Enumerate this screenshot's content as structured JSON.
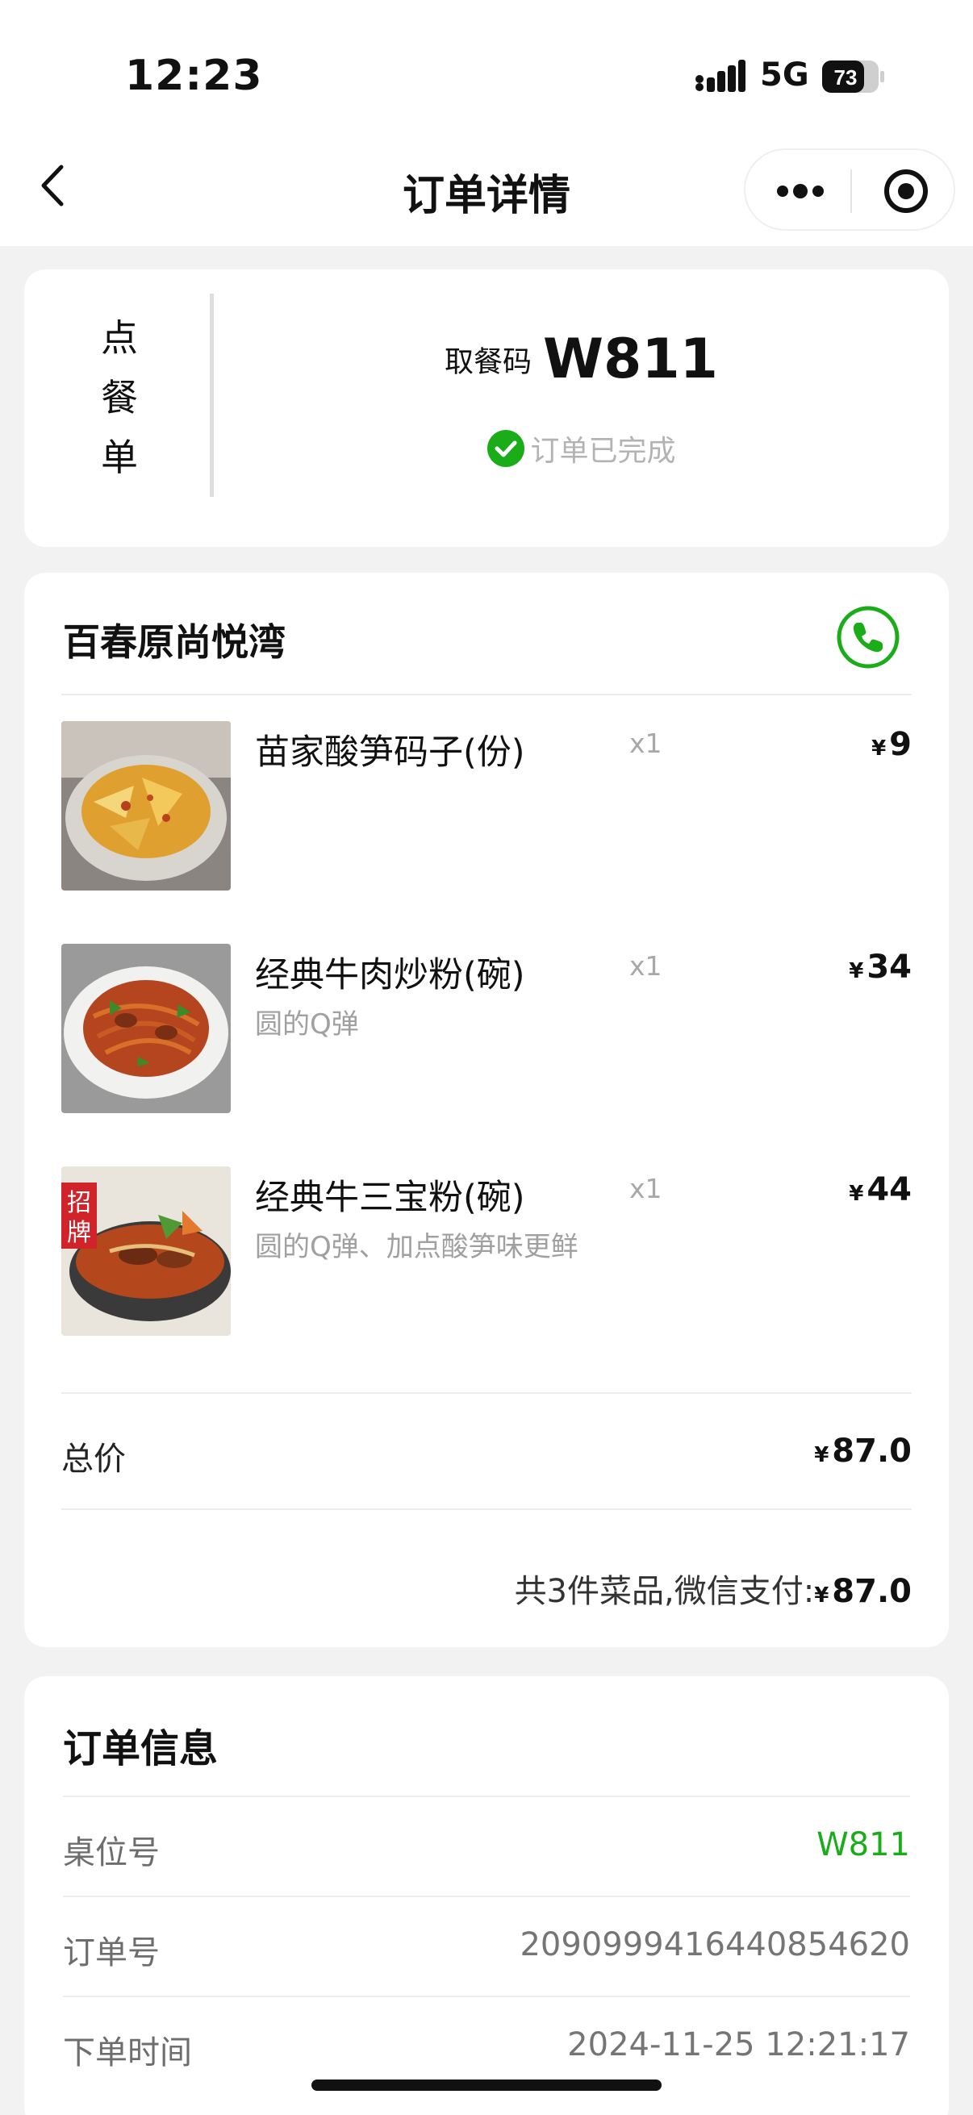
{
  "status_bar": {
    "time": "12:23",
    "network": "5G",
    "battery": "73"
  },
  "nav": {
    "title": "订单详情",
    "more_icon": "more-dots-icon",
    "close_icon": "record-target-icon"
  },
  "pickup_card": {
    "vertical_label": [
      "点",
      "餐",
      "单"
    ],
    "code_label": "取餐码",
    "code": "W811",
    "status": "订单已完成"
  },
  "store": {
    "name": "百春原尚悦湾"
  },
  "items": [
    {
      "name": "苗家酸笋码子(份)",
      "qty": "x1",
      "currency": "¥",
      "price": "9",
      "note": ""
    },
    {
      "name": "经典牛肉炒粉(碗)",
      "qty": "x1",
      "currency": "¥",
      "price": "34",
      "note": "圆的Q弹"
    },
    {
      "name": "经典牛三宝粉(碗)",
      "qty": "x1",
      "currency": "¥",
      "price": "44",
      "note": "圆的Q弹、加点酸笋味更鲜"
    }
  ],
  "total": {
    "label": "总价",
    "currency": "¥",
    "amount": "87.0"
  },
  "summary": {
    "text": "共3件菜品,微信支付:",
    "currency": "¥",
    "amount": "87.0"
  },
  "order_info": {
    "title": "订单信息",
    "rows": [
      {
        "label": "桌位号",
        "value": "W811"
      },
      {
        "label": "订单号",
        "value": "2090999416440854620"
      },
      {
        "label": "下单时间",
        "value": "2024-11-25 12:21:17"
      }
    ]
  },
  "colors": {
    "accent_green": "#1aad19",
    "background": "#f2f2f2"
  }
}
